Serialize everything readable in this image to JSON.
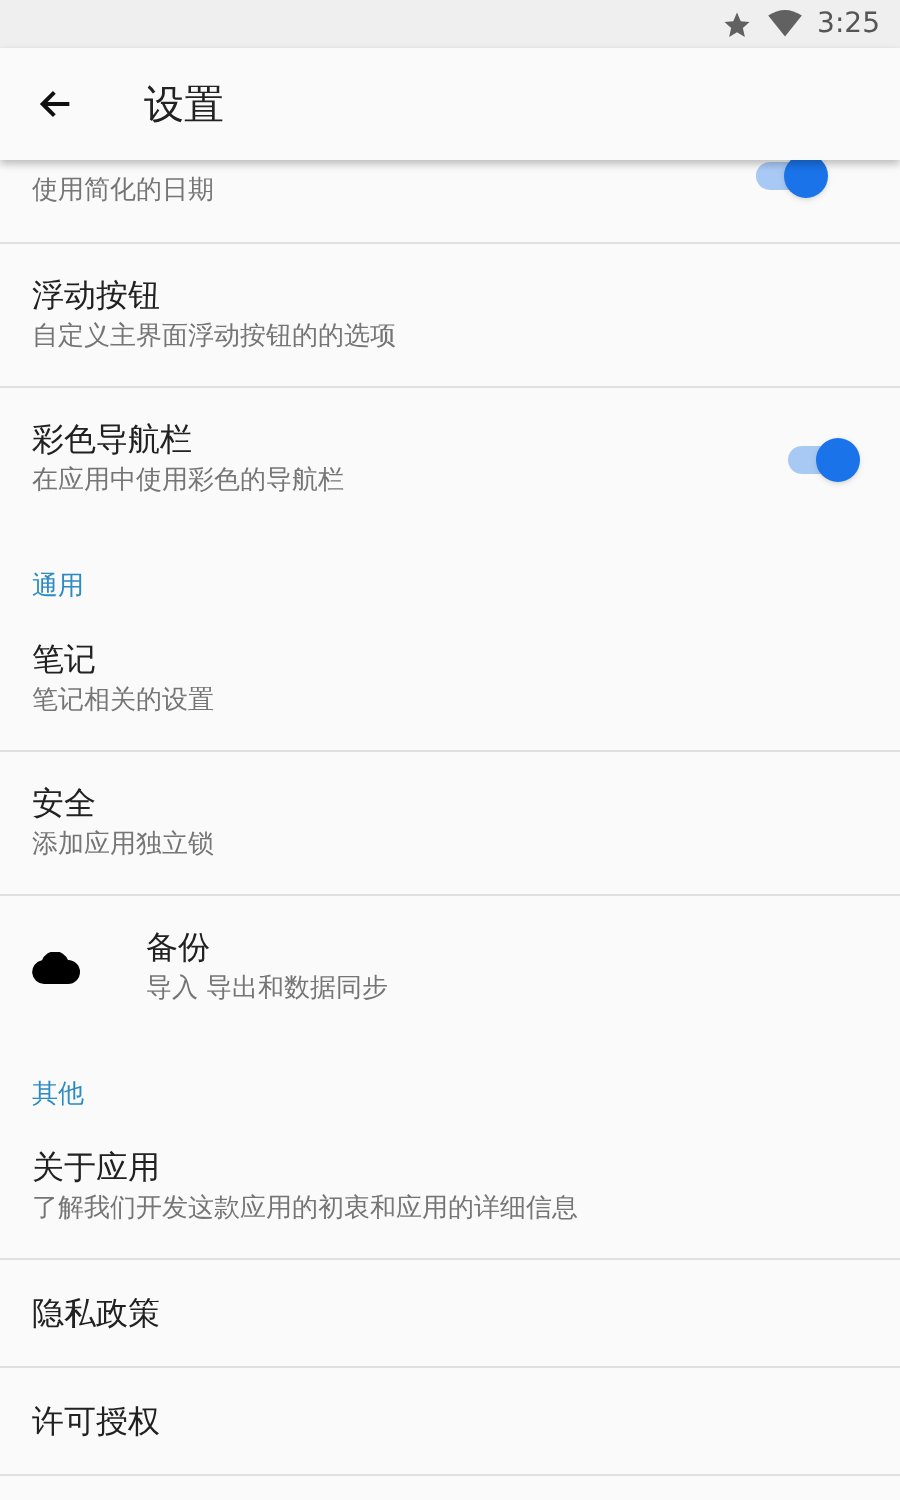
{
  "status_bar": {
    "time": "3:25"
  },
  "app_bar": {
    "title": "设置"
  },
  "list": [
    {
      "kind": "switch",
      "subtitle": "使用简化的日期",
      "on": true
    },
    {
      "kind": "item",
      "title": "浮动按钮",
      "subtitle": "自定义主界面浮动按钮的的选项"
    },
    {
      "kind": "switch",
      "title": "彩色导航栏",
      "subtitle": "在应用中使用彩色的导航栏",
      "on": true
    },
    {
      "kind": "header",
      "title": "通用"
    },
    {
      "kind": "item",
      "title": "笔记",
      "subtitle": "笔记相关的设置"
    },
    {
      "kind": "item",
      "title": "安全",
      "subtitle": "添加应用独立锁"
    },
    {
      "kind": "cloud_item",
      "title": "备份",
      "subtitle": "导入 导出和数据同步"
    },
    {
      "kind": "header",
      "title": "其他"
    },
    {
      "kind": "item",
      "title": "关于应用",
      "subtitle": "了解我们开发这款应用的初衷和应用的详细信息"
    },
    {
      "kind": "item",
      "title": "隐私政策"
    },
    {
      "kind": "item",
      "title": "许可授权"
    }
  ]
}
